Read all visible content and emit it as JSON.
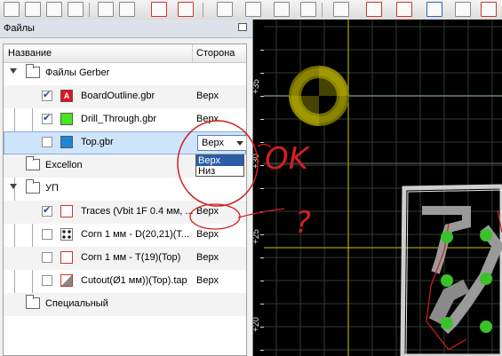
{
  "panel": {
    "title": "Файлы",
    "columns": {
      "name": "Название",
      "side": "Сторона"
    }
  },
  "groups": {
    "gerber": "Файлы Gerber",
    "excellon": "Excellon",
    "up": "УП",
    "special": "Специальный"
  },
  "gerber_files": [
    {
      "name": "BoardOutline.gbr",
      "side": "Верх",
      "checked": true,
      "color": "#e8141c",
      "icon": "A"
    },
    {
      "name": "Drill_Through.gbr",
      "side": "Верх",
      "checked": true,
      "color": "#44e81a"
    },
    {
      "name": "Top.gbr",
      "side": "Верх",
      "checked": false,
      "color": "#1f86d6"
    }
  ],
  "toolpaths": [
    {
      "name": "Traces (Vbit 1F 0.4 мм, ...",
      "side": "Верх",
      "checked": true,
      "icon": "traces-icon"
    },
    {
      "name": "Corn 1 мм - D(20,21)(T...",
      "side": "Верх",
      "checked": false,
      "icon": "drill-icon"
    },
    {
      "name": "Corn 1 мм - T(19)(Top)",
      "side": "Верх",
      "checked": false,
      "icon": "traces-icon"
    },
    {
      "name": "Cutout(Ø1 мм))(Top).tap",
      "side": "Верх",
      "checked": false,
      "icon": "cutout-icon"
    }
  ],
  "dropdown": {
    "selected": "Верх",
    "options": [
      "Верх",
      "Низ"
    ]
  },
  "ruler": {
    "labels": [
      "+35",
      "+30",
      "+25",
      "+20"
    ]
  },
  "annotations": {
    "ok": "OK",
    "question": "?"
  },
  "colors": {
    "accent_select": "#2b5ea8",
    "annotation_red": "#d22020",
    "grid_yellow": "#c8c800",
    "pad_green": "#3bc12a",
    "outline_red": "#d42020"
  }
}
